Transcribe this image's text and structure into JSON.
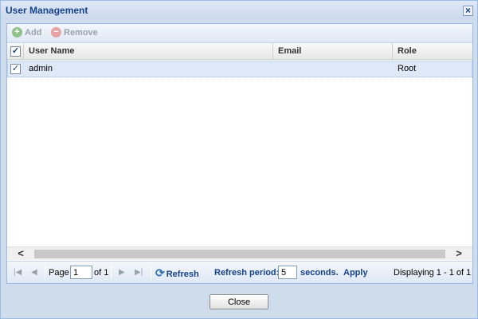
{
  "window": {
    "title": "User Management"
  },
  "toolbar": {
    "add_label": "Add",
    "remove_label": "Remove"
  },
  "grid": {
    "columns": [
      "User Name",
      "Email",
      "Role"
    ],
    "rows": [
      {
        "selected": true,
        "user_name": "admin",
        "email": "",
        "role": "Root"
      }
    ]
  },
  "pager": {
    "page_label": "Page",
    "page_value": "1",
    "of_label": "of 1",
    "refresh_label": "Refresh",
    "refresh_period_label": "Refresh period:",
    "refresh_period_value": "5",
    "seconds_label": "seconds.",
    "apply_label": "Apply",
    "displaying_label": "Displaying 1 - 1 of 1"
  },
  "footer": {
    "close_label": "Close"
  },
  "icons": {
    "add": "plus-circle-icon",
    "remove": "minus-circle-icon",
    "refresh": "refresh-icon"
  },
  "colors": {
    "title": "#15428b",
    "selected_row": "#dfe8f6",
    "border": "#99bbe8"
  }
}
